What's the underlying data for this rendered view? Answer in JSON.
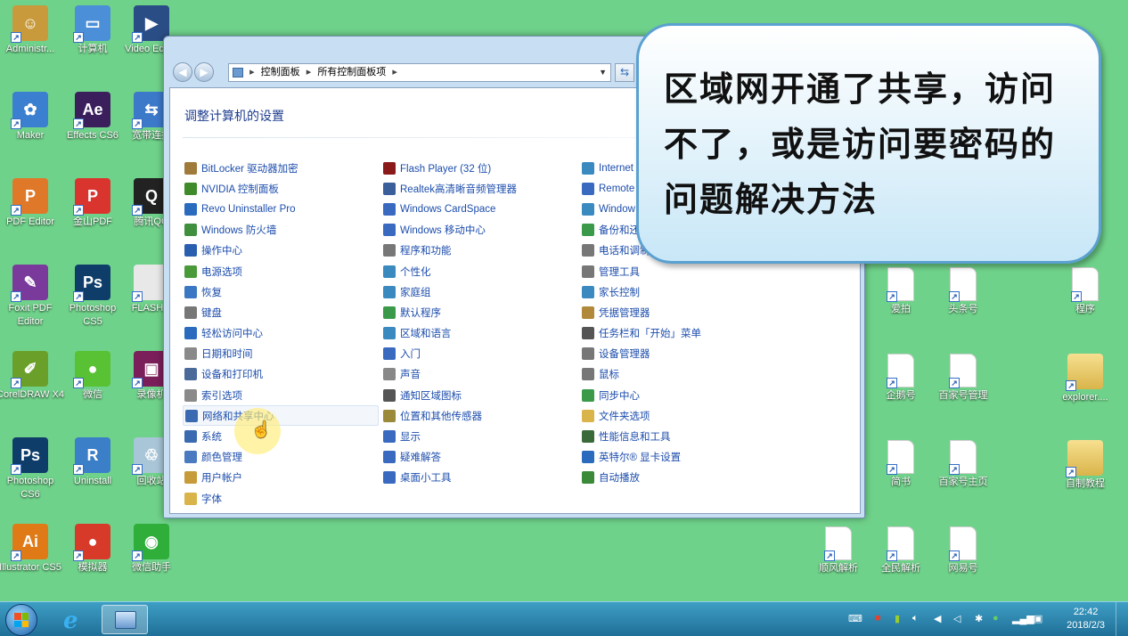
{
  "desktop_icons_left": [
    {
      "label": "Administr...",
      "color": "#c89a3c",
      "glyph": "☺"
    },
    {
      "label": "计算机",
      "color": "#4a8fd8",
      "glyph": "▭"
    },
    {
      "label": "Video Editor",
      "color": "#2b4d86",
      "glyph": "▶"
    },
    {
      "label": "Maker",
      "color": "#3b7fd0",
      "glyph": "✿"
    },
    {
      "label": "Effects CS6",
      "color": "#3a1f5c",
      "glyph": "Ae"
    },
    {
      "label": "宽带连接",
      "color": "#3d79c9",
      "glyph": "⇆"
    },
    {
      "label": "PDF Editor",
      "color": "#e0782a",
      "glyph": "P"
    },
    {
      "label": "金山PDF",
      "color": "#d9352e",
      "glyph": "P"
    },
    {
      "label": "腾讯QQ",
      "color": "#222222",
      "glyph": "Q"
    },
    {
      "label": "Foxit PDF Editor",
      "color": "#7a3a9c",
      "glyph": "✎"
    },
    {
      "label": "Photoshop CS5",
      "color": "#0f3d6a",
      "glyph": "Ps"
    },
    {
      "label": "FLASH...",
      "color": "#e8e8e8",
      "glyph": ""
    },
    {
      "label": "CorelDRAW X4",
      "color": "#6aa02a",
      "glyph": "✐"
    },
    {
      "label": "微信",
      "color": "#58c234",
      "glyph": "●"
    },
    {
      "label": "录像机",
      "color": "#7a1f5a",
      "glyph": "▣"
    },
    {
      "label": "Photoshop CS6",
      "color": "#0f3d6a",
      "glyph": "Ps"
    },
    {
      "label": "Uninstall",
      "color": "#3a7fc8",
      "glyph": "R"
    },
    {
      "label": "回收站",
      "color": "#a9c6d8",
      "glyph": "♲"
    },
    {
      "label": "Illustrator CS5",
      "color": "#e07a16",
      "glyph": "Ai"
    },
    {
      "label": "模拟器",
      "color": "#d83a2a",
      "glyph": "●"
    },
    {
      "label": "微信助手",
      "color": "#2fae3a",
      "glyph": "◉"
    }
  ],
  "desktop_icons_right": [
    {
      "label": "爱拍"
    },
    {
      "label": "头条号"
    },
    {
      "label": "程序"
    },
    {
      "label": "企鹅号"
    },
    {
      "label": "百家号管理"
    },
    {
      "label": "explorer...."
    },
    {
      "label": "简书"
    },
    {
      "label": "百家号主页"
    },
    {
      "label": "自制教程"
    },
    {
      "label": "顺风解析"
    },
    {
      "label": "全民解析"
    },
    {
      "label": "网易号"
    }
  ],
  "window": {
    "breadcrumb": [
      "控制面板",
      "所有控制面板项"
    ],
    "title": "调整计算机的设置",
    "columns": [
      [
        {
          "label": "BitLocker 驱动器加密",
          "icon": "lock-icon",
          "color": "#a07a3a"
        },
        {
          "label": "NVIDIA 控制面板",
          "icon": "nvidia-icon",
          "color": "#3f8a2a"
        },
        {
          "label": "Revo Uninstaller Pro",
          "icon": "uninstaller-icon",
          "color": "#2a6bbd"
        },
        {
          "label": "Windows 防火墙",
          "icon": "firewall-icon",
          "color": "#3f8f3f"
        },
        {
          "label": "操作中心",
          "icon": "flag-icon",
          "color": "#2a5fb0"
        },
        {
          "label": "电源选项",
          "icon": "power-icon",
          "color": "#4a9a3a"
        },
        {
          "label": "恢复",
          "icon": "recovery-icon",
          "color": "#3b77c2"
        },
        {
          "label": "键盘",
          "icon": "keyboard-icon",
          "color": "#777777"
        },
        {
          "label": "轻松访问中心",
          "icon": "accessibility-icon",
          "color": "#2a6bbd"
        },
        {
          "label": "日期和时间",
          "icon": "clock-icon",
          "color": "#8a8a8a"
        },
        {
          "label": "设备和打印机",
          "icon": "printer-icon",
          "color": "#4a6a9a"
        },
        {
          "label": "索引选项",
          "icon": "index-icon",
          "color": "#8a8a8a"
        },
        {
          "label": "网络和共享中心",
          "icon": "network-icon",
          "color": "#3a6ab0"
        },
        {
          "label": "系统",
          "icon": "system-icon",
          "color": "#3a6ab0"
        },
        {
          "label": "颜色管理",
          "icon": "color-icon",
          "color": "#4a7ac0"
        },
        {
          "label": "用户帐户",
          "icon": "users-icon",
          "color": "#c79a3a"
        },
        {
          "label": "字体",
          "icon": "font-folder-icon",
          "color": "#d9b44a"
        }
      ],
      [
        {
          "label": "Flash Player (32 位)",
          "icon": "flash-icon",
          "color": "#8a1a1a"
        },
        {
          "label": "Realtek高清晰音频管理器",
          "icon": "audio-icon",
          "color": "#3a5f9a"
        },
        {
          "label": "Windows CardSpace",
          "icon": "cardspace-icon",
          "color": "#3a6ac0"
        },
        {
          "label": "Windows 移动中心",
          "icon": "mobility-icon",
          "color": "#3a6ac0"
        },
        {
          "label": "程序和功能",
          "icon": "programs-icon",
          "color": "#777777"
        },
        {
          "label": "个性化",
          "icon": "personalize-icon",
          "color": "#3a8ac0"
        },
        {
          "label": "家庭组",
          "icon": "homegroup-icon",
          "color": "#3a8ac0"
        },
        {
          "label": "默认程序",
          "icon": "default-programs-icon",
          "color": "#3a9a4a"
        },
        {
          "label": "区域和语言",
          "icon": "region-icon",
          "color": "#3a8ac0"
        },
        {
          "label": "入门",
          "icon": "getting-started-icon",
          "color": "#3a6ac0"
        },
        {
          "label": "声音",
          "icon": "speaker-icon",
          "color": "#888888"
        },
        {
          "label": "通知区域图标",
          "icon": "notification-icon",
          "color": "#555555"
        },
        {
          "label": "位置和其他传感器",
          "icon": "sensor-icon",
          "color": "#9a8a3a"
        },
        {
          "label": "显示",
          "icon": "display-icon",
          "color": "#3a6ac0"
        },
        {
          "label": "疑难解答",
          "icon": "troubleshoot-icon",
          "color": "#3a6ac0"
        },
        {
          "label": "桌面小工具",
          "icon": "gadgets-icon",
          "color": "#3a6ac0"
        }
      ],
      [
        {
          "label": "Internet",
          "icon": "internet-icon",
          "color": "#3a8ac0"
        },
        {
          "label": "Remote",
          "icon": "remote-icon",
          "color": "#3a6ac0"
        },
        {
          "label": "Window",
          "icon": "window-icon",
          "color": "#3a8ac0"
        },
        {
          "label": "备份和还",
          "icon": "backup-icon",
          "color": "#3a9a4a"
        },
        {
          "label": "电话和调制",
          "icon": "phone-icon",
          "color": "#777777"
        },
        {
          "label": "管理工具",
          "icon": "admin-tools-icon",
          "color": "#777777"
        },
        {
          "label": "家长控制",
          "icon": "parental-icon",
          "color": "#3a8ac0"
        },
        {
          "label": "凭据管理器",
          "icon": "credential-icon",
          "color": "#b08a3a"
        },
        {
          "label": "任务栏和「开始」菜单",
          "icon": "taskbar-icon",
          "color": "#555555"
        },
        {
          "label": "设备管理器",
          "icon": "device-manager-icon",
          "color": "#777777"
        },
        {
          "label": "鼠标",
          "icon": "mouse-icon",
          "color": "#777777"
        },
        {
          "label": "同步中心",
          "icon": "sync-icon",
          "color": "#3a9a4a"
        },
        {
          "label": "文件夹选项",
          "icon": "folder-options-icon",
          "color": "#d9b44a"
        },
        {
          "label": "性能信息和工具",
          "icon": "performance-icon",
          "color": "#3a6a3a"
        },
        {
          "label": "英特尔® 显卡设置",
          "icon": "intel-icon",
          "color": "#2a6bbd"
        },
        {
          "label": "自动播放",
          "icon": "autoplay-icon",
          "color": "#3a8a3a"
        }
      ]
    ]
  },
  "callout": {
    "text": "区域网开通了共享，访问不了，或是访问要密码的问题解决方法"
  },
  "taskbar": {
    "time": "22:42",
    "date": "2018/2/3"
  }
}
